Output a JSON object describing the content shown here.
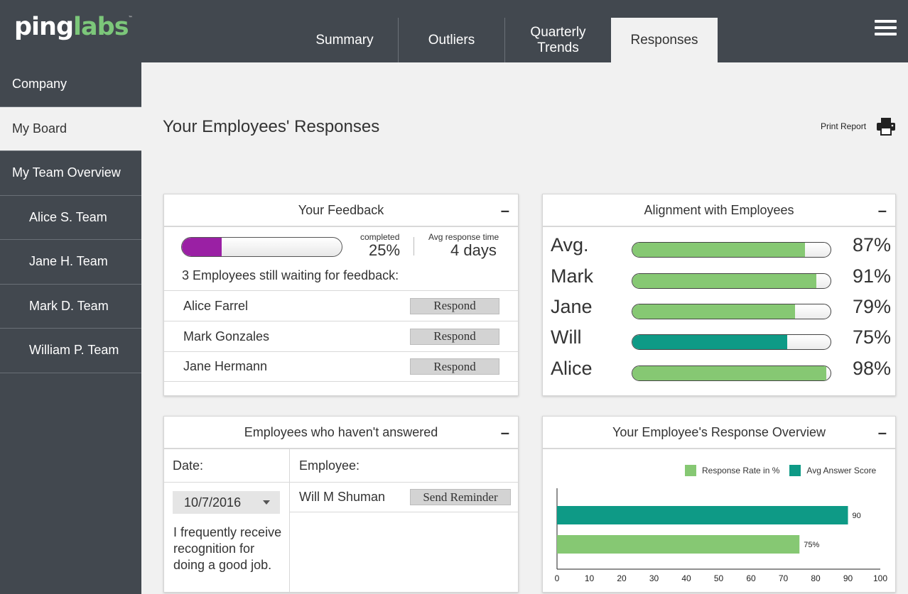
{
  "brand": {
    "logo_part1": "ping",
    "logo_part2": "labs",
    "trademark": "™"
  },
  "tabs": [
    {
      "label": "Summary"
    },
    {
      "label": "Outliers"
    },
    {
      "label": "Quarterly Trends"
    },
    {
      "label": "Responses"
    }
  ],
  "sidebar": {
    "items": [
      {
        "label": "Company"
      },
      {
        "label": "My Board"
      },
      {
        "label": "My Team Overview"
      },
      {
        "label": "Alice S. Team"
      },
      {
        "label": "Jane H. Team"
      },
      {
        "label": "Mark D. Team"
      },
      {
        "label": "William P. Team"
      }
    ]
  },
  "page": {
    "title": "Your Employees' Responses",
    "print_label": "Print Report"
  },
  "feedback": {
    "title": "Your Feedback",
    "collapse": "–",
    "completed_label": "completed",
    "completed_value": "25%",
    "completed_fraction": 0.25,
    "avg_label": "Avg response time",
    "avg_value": "4 days",
    "waiting_text": "3 Employees still waiting for feedback:",
    "employees": [
      {
        "name": "Alice Farrel",
        "action": "Respond"
      },
      {
        "name": "Mark Gonzales",
        "action": "Respond"
      },
      {
        "name": "Jane Hermann",
        "action": "Respond"
      }
    ],
    "progress_color": "#9a20a4"
  },
  "alignment": {
    "title": "Alignment with Employees",
    "collapse": "–",
    "rows": [
      {
        "name": "Avg.",
        "value": "87%",
        "fraction": 0.87,
        "color": "#86c873"
      },
      {
        "name": "Mark",
        "value": "91%",
        "fraction": 0.93,
        "color": "#86c873"
      },
      {
        "name": "Jane",
        "value": "79%",
        "fraction": 0.82,
        "color": "#86c873"
      },
      {
        "name": "Will",
        "value": "75%",
        "fraction": 0.78,
        "color": "#0e9a86"
      },
      {
        "name": "Alice",
        "value": "98%",
        "fraction": 0.98,
        "color": "#86c873"
      }
    ]
  },
  "not_answered": {
    "title": "Employees who haven't answered",
    "collapse": "–",
    "date_header": "Date:",
    "employee_header": "Employee:",
    "date_value": "10/7/2016",
    "question": "I frequently receive recognition for doing a good job.",
    "employees": [
      {
        "name": "Will M Shuman",
        "action": "Send Reminder"
      }
    ]
  },
  "overview": {
    "title": "Your Employee's Response Overview",
    "collapse": "–",
    "legend": [
      {
        "label": "Response Rate in %",
        "color": "#86c873"
      },
      {
        "label": "Avg Answer Score",
        "color": "#0e9a86"
      }
    ]
  },
  "chart_data": {
    "type": "bar",
    "orientation": "horizontal",
    "title": "Your Employee's Response Overview",
    "xlim": [
      0,
      100
    ],
    "xticks": [
      0,
      10,
      20,
      30,
      40,
      50,
      60,
      70,
      80,
      90,
      100
    ],
    "series": [
      {
        "name": "Avg Answer Score",
        "value": 90,
        "label": "90",
        "color": "#0e9a86"
      },
      {
        "name": "Response Rate in %",
        "value": 75,
        "label": "75%",
        "color": "#86c873"
      }
    ],
    "legend_position": "top-right",
    "grid": false
  }
}
